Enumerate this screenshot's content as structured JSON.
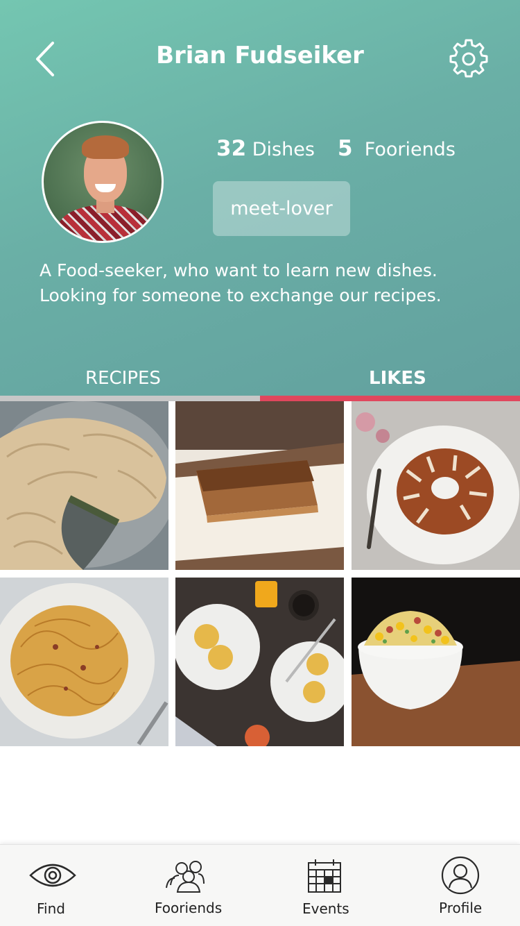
{
  "header": {
    "title": "Brian Fudseiker",
    "back_icon": "chevron-left-icon",
    "settings_icon": "gear-icon",
    "background_color": "#6aafa6"
  },
  "profile": {
    "avatar": "profile-photo",
    "dishes_count": "32",
    "dishes_label": "Dishes",
    "friends_count": "5",
    "friends_label": "Fooriends",
    "tag": "meet-lover",
    "bio_line1": "A Food-seeker, who want to learn new dishes.",
    "bio_line2": "Looking for someone to exchange our recipes."
  },
  "tabs": [
    {
      "label": "RECIPES",
      "active": false
    },
    {
      "label": "LIKES",
      "active": true,
      "indicator_color": "#e0475d"
    }
  ],
  "grid": [
    {
      "name": "spanakopita-pie"
    },
    {
      "name": "pecan-pie-slice"
    },
    {
      "name": "bundt-cake"
    },
    {
      "name": "spaghetti-plate"
    },
    {
      "name": "eggs-benedict"
    },
    {
      "name": "corn-salad-bowl"
    }
  ],
  "bottom_nav": [
    {
      "label": "Find",
      "icon": "eye-icon"
    },
    {
      "label": "Fooriends",
      "icon": "group-icon"
    },
    {
      "label": "Events",
      "icon": "calendar-icon"
    },
    {
      "label": "Profile",
      "icon": "user-circle-icon"
    }
  ]
}
